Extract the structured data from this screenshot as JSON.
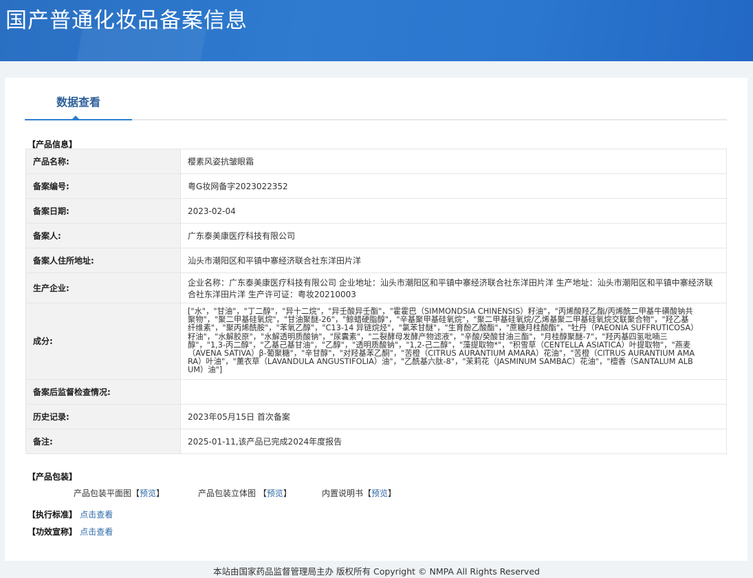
{
  "header": {
    "title": "国产普通化妆品备案信息"
  },
  "tabs": [
    {
      "label": "数据查看"
    }
  ],
  "product_info": {
    "section_title": "【产品信息】",
    "rows": [
      {
        "label": "产品名称:",
        "value": "樱素风姿抗皱眼霜"
      },
      {
        "label": "备案编号:",
        "value": "粤G妆网备字2023022352"
      },
      {
        "label": "备案日期:",
        "value": "2023-02-04"
      },
      {
        "label": "备案人:",
        "value": "广东泰美康医疗科技有限公司"
      },
      {
        "label": "备案人住所地址:",
        "value": "汕头市潮阳区和平镇中寨经济联合社东洋田片洋"
      },
      {
        "label": "生产企业:",
        "value": "企业名称：广东泰美康医疗科技有限公司 企业地址：汕头市潮阳区和平镇中寨经济联合社东洋田片洋 生产地址：汕头市潮阳区和平镇中寨经济联合社东洋田片洋 生产许可证：粤妆20210003"
      },
      {
        "label": "成分:",
        "value": "[\"水\"，\"甘油\"，\"丁二醇\"，\"异十二烷\"，\"异壬酸异壬酯\"，\"霍霍巴（SIMMONDSIA CHINENSIS）籽油\"，\"丙烯酸羟乙酯/丙烯酰二甲基牛磺酸钠共聚物\"，\"聚二甲基硅氧烷\"，\"甘油聚醚-26\"，\"鲸蜡硬脂醇\"，\"辛基聚甲基硅氧烷\"，\"聚二甲基硅氧烷/乙烯基聚二甲基硅氧烷交联聚合物\"，\"羟乙基纤维素\"，\"聚丙烯酰胺\"，\"苯氧乙醇\"，\"C13-14 异链烷烃\"，\"氯苯甘醚\"，\"生育酚乙酸酯\"，\"蔗糖月桂酸酯\"，\"牡丹（PAEONIA SUFFRUTICOSA）籽油\"，\"水解胶原\"，\"水解透明质酸钠\"，\"尿囊素\"，\"二裂酵母发酵产物滤液\"，\"辛酸/癸酸甘油三酯\"，\"月桂醇聚醚-7\"，\"羟丙基四氢吡喃三醇\"，\"1,3-丙二醇\"，\"乙基己基甘油\"，\"乙醇\"，\"透明质酸钠\"，\"1,2-己二醇\"，\"藻提取物*\"，\"积雪草（CENTELLA ASIATICA）叶提取物\"，\"燕麦（AVENA SATIVA）β-葡聚糖\"，\"辛甘醇\"，\"对羟基苯乙酮\"，\"苦橙（CITRUS AURANTIUM AMARA）花油\"，\"苦橙（CITRUS AURANTIUM AMARA）叶油\"，\"薰衣草（LAVANDULA ANGUSTIFOLIA）油\"，\"乙酰基六肽-8\"，\"茉莉花（JASMINUM SAMBAC）花油\"，\"檀香（SANTALUM ALBUM）油\"]"
      },
      {
        "label": "备案后监督检查情况:",
        "value": ""
      },
      {
        "label": "历史记录:",
        "value": "2023年05月15日 首次备案"
      },
      {
        "label": "备注:",
        "value": "2025-01-11,该产品已完成2024年度报告"
      }
    ]
  },
  "packaging": {
    "section_title": "【产品包装】",
    "items": [
      {
        "label": "产品包装平面图",
        "link": "预览"
      },
      {
        "label": "产品包装立体图 ",
        "link": "预览"
      },
      {
        "label": "内置说明书",
        "link": "预览"
      }
    ]
  },
  "standard": {
    "label": "【执行标准】",
    "link": "点击查看"
  },
  "efficacy": {
    "label": "【功效宣称】",
    "link": "点击查看"
  },
  "footer": {
    "text": "本站由国家药品监督管理局主办 版权所有 Copyright © NMPA All Rights Reserved"
  }
}
